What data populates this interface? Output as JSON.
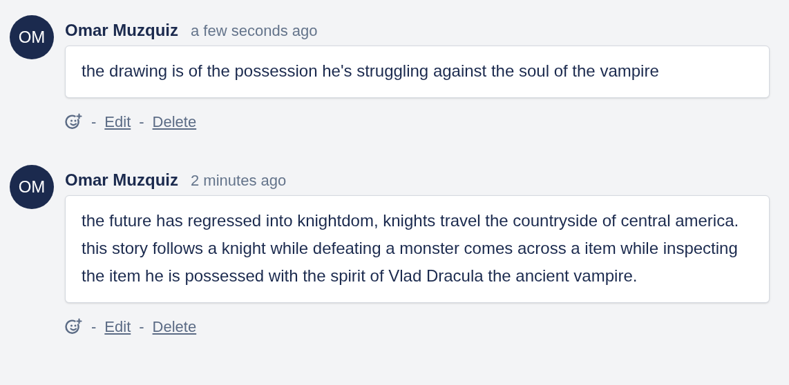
{
  "comments": [
    {
      "avatar": "OM",
      "author": "Omar Muzquiz",
      "time": "a few seconds ago",
      "body": "the drawing is of the possession he's struggling against the soul of the vampire",
      "actions": [
        {
          "kind": "separator",
          "label": "-"
        },
        {
          "kind": "link",
          "label": "Edit"
        },
        {
          "kind": "separator",
          "label": "-"
        },
        {
          "kind": "link",
          "label": "Delete"
        }
      ]
    },
    {
      "avatar": "OM",
      "author": "Omar Muzquiz",
      "time": "2 minutes ago",
      "body": "the future has regressed into knightdom, knights travel the countryside of central america. this story follows a knight while defeating a monster comes across a item while inspecting the item he is possessed with the spirit of Vlad Dracula the ancient vampire.",
      "actions": [
        {
          "kind": "separator",
          "label": "-"
        },
        {
          "kind": "link",
          "label": "Edit"
        },
        {
          "kind": "separator",
          "label": "-"
        },
        {
          "kind": "link",
          "label": "Delete"
        }
      ]
    }
  ]
}
